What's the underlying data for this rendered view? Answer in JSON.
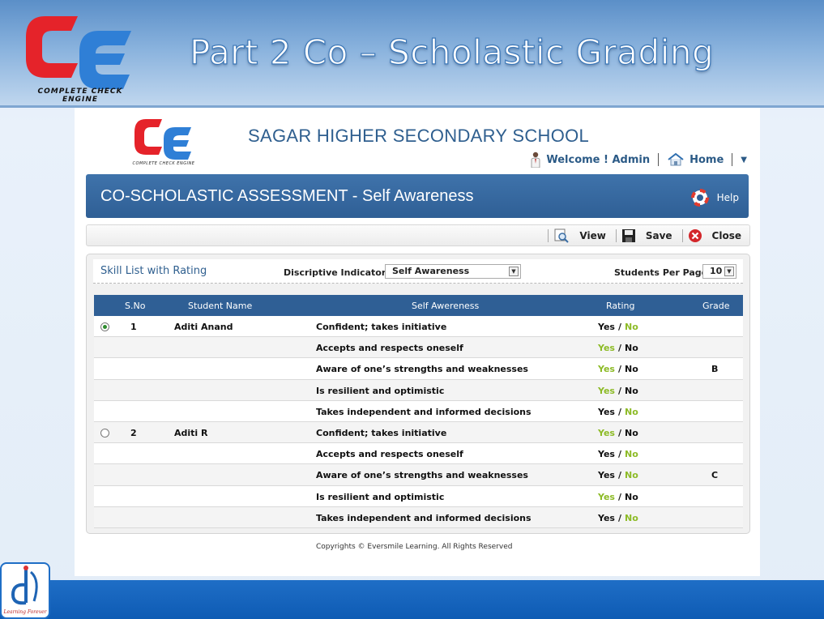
{
  "slide": {
    "title": "Part 2 Co – Scholastic Grading",
    "logo_text": "COMPLETE CHECK ENGINE"
  },
  "app": {
    "logo_text": "COMPLETE CHECK ENGINE",
    "school_name": "SAGAR HIGHER SECONDARY SCHOOL",
    "welcome": "Welcome ! Admin",
    "home": "Home",
    "menu_caret": "▼"
  },
  "header": {
    "title": "CO-SCHOLASTIC ASSESSMENT - Self Awareness",
    "help": "Help"
  },
  "toolbar": {
    "view": "View",
    "save": "Save",
    "close": "Close"
  },
  "panel": {
    "skill_title": "Skill List with Rating",
    "indicators_label": "Discriptive Indicators",
    "indicators_value": "Self Awareness",
    "students_per_page_label": "Students Per Page",
    "students_per_page_value": "10"
  },
  "table": {
    "columns": {
      "sno": "S.No",
      "student_name": "Student Name",
      "self_awareness": "Self Awereness",
      "rating": "Rating",
      "grade": "Grade"
    },
    "rating_sep": "/",
    "rows": [
      {
        "sno": "1",
        "name": "Aditi Anand",
        "indicator": "Confident; takes initiative",
        "yes": "Yes",
        "no": "No",
        "selected": "No",
        "grade": ""
      },
      {
        "sno": "",
        "name": "",
        "indicator": "Accepts and respects oneself",
        "yes": "Yes",
        "no": "No",
        "selected": "Yes",
        "grade": ""
      },
      {
        "sno": "",
        "name": "",
        "indicator": "Aware of one’s strengths and weaknesses",
        "yes": "Yes",
        "no": "No",
        "selected": "Yes",
        "grade": "B"
      },
      {
        "sno": "",
        "name": "",
        "indicator": "Is resilient and optimistic",
        "yes": "Yes",
        "no": "No",
        "selected": "Yes",
        "grade": ""
      },
      {
        "sno": "",
        "name": "",
        "indicator": "Takes independent and informed decisions",
        "yes": "Yes",
        "no": "No",
        "selected": "No",
        "grade": ""
      },
      {
        "sno": "2",
        "name": "Aditi R",
        "indicator": "Confident; takes initiative",
        "yes": "Yes",
        "no": "No",
        "selected": "Yes",
        "grade": ""
      },
      {
        "sno": "",
        "name": "",
        "indicator": "Accepts and respects oneself",
        "yes": "Yes",
        "no": "No",
        "selected": "No",
        "grade": ""
      },
      {
        "sno": "",
        "name": "",
        "indicator": "Aware of one’s strengths and weaknesses",
        "yes": "Yes",
        "no": "No",
        "selected": "No",
        "grade": "C"
      },
      {
        "sno": "",
        "name": "",
        "indicator": "Is resilient and optimistic",
        "yes": "Yes",
        "no": "No",
        "selected": "Yes",
        "grade": ""
      },
      {
        "sno": "",
        "name": "",
        "indicator": "Takes independent and informed decisions",
        "yes": "Yes",
        "no": "No",
        "selected": "No",
        "grade": ""
      }
    ]
  },
  "footer": {
    "copyright": "Copyrights © Eversmile Learning. All Rights Reserved"
  },
  "corner_logo": {
    "caption": "Learning Forever"
  },
  "colors": {
    "accent_blue": "#2f5f95",
    "selected_green": "#8dbb27"
  }
}
